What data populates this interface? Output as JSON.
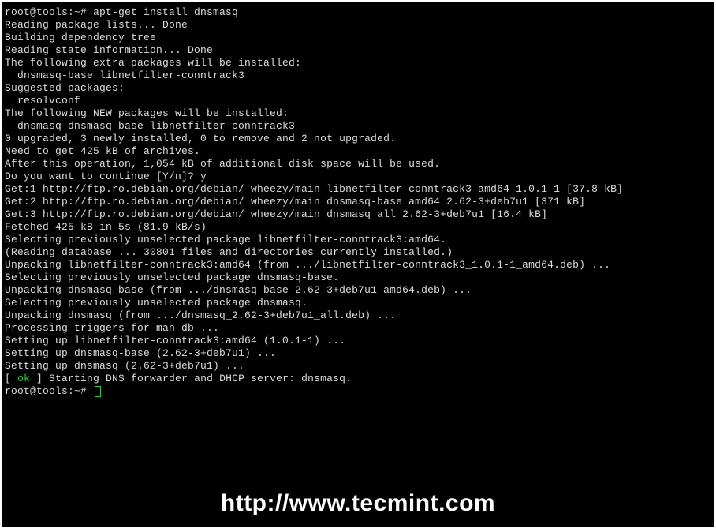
{
  "terminal": {
    "lines": [
      {
        "type": "prompt",
        "prompt": "root@tools:~#",
        "cmd": " apt-get install dnsmasq"
      },
      {
        "type": "plain",
        "text": "Reading package lists... Done"
      },
      {
        "type": "plain",
        "text": "Building dependency tree"
      },
      {
        "type": "plain",
        "text": "Reading state information... Done"
      },
      {
        "type": "plain",
        "text": "The following extra packages will be installed:"
      },
      {
        "type": "plain",
        "text": "  dnsmasq-base libnetfilter-conntrack3"
      },
      {
        "type": "plain",
        "text": "Suggested packages:"
      },
      {
        "type": "plain",
        "text": "  resolvconf"
      },
      {
        "type": "plain",
        "text": "The following NEW packages will be installed:"
      },
      {
        "type": "plain",
        "text": "  dnsmasq dnsmasq-base libnetfilter-conntrack3"
      },
      {
        "type": "plain",
        "text": "0 upgraded, 3 newly installed, 0 to remove and 2 not upgraded."
      },
      {
        "type": "plain",
        "text": "Need to get 425 kB of archives."
      },
      {
        "type": "plain",
        "text": "After this operation, 1,054 kB of additional disk space will be used."
      },
      {
        "type": "plain",
        "text": "Do you want to continue [Y/n]? y"
      },
      {
        "type": "plain",
        "text": "Get:1 http://ftp.ro.debian.org/debian/ wheezy/main libnetfilter-conntrack3 amd64 1.0.1-1 [37.8 kB]"
      },
      {
        "type": "plain",
        "text": "Get:2 http://ftp.ro.debian.org/debian/ wheezy/main dnsmasq-base amd64 2.62-3+deb7u1 [371 kB]"
      },
      {
        "type": "plain",
        "text": "Get:3 http://ftp.ro.debian.org/debian/ wheezy/main dnsmasq all 2.62-3+deb7u1 [16.4 kB]"
      },
      {
        "type": "plain",
        "text": "Fetched 425 kB in 5s (81.9 kB/s)"
      },
      {
        "type": "plain",
        "text": "Selecting previously unselected package libnetfilter-conntrack3:amd64."
      },
      {
        "type": "plain",
        "text": "(Reading database ... 30801 files and directories currently installed.)"
      },
      {
        "type": "plain",
        "text": "Unpacking libnetfilter-conntrack3:amd64 (from .../libnetfilter-conntrack3_1.0.1-1_amd64.deb) ..."
      },
      {
        "type": "plain",
        "text": "Selecting previously unselected package dnsmasq-base."
      },
      {
        "type": "plain",
        "text": "Unpacking dnsmasq-base (from .../dnsmasq-base_2.62-3+deb7u1_amd64.deb) ..."
      },
      {
        "type": "plain",
        "text": "Selecting previously unselected package dnsmasq."
      },
      {
        "type": "plain",
        "text": "Unpacking dnsmasq (from .../dnsmasq_2.62-3+deb7u1_all.deb) ..."
      },
      {
        "type": "plain",
        "text": "Processing triggers for man-db ..."
      },
      {
        "type": "plain",
        "text": "Setting up libnetfilter-conntrack3:amd64 (1.0.1-1) ..."
      },
      {
        "type": "plain",
        "text": "Setting up dnsmasq-base (2.62-3+deb7u1) ..."
      },
      {
        "type": "plain",
        "text": "Setting up dnsmasq (2.62-3+deb7u1) ..."
      },
      {
        "type": "ok",
        "pre": "[ ",
        "ok": "ok",
        "post": " ] Starting DNS forwarder and DHCP server: dnsmasq."
      },
      {
        "type": "prompt_cursor",
        "prompt": "root@tools:~#",
        "cmd": " "
      }
    ]
  },
  "watermark": "http://www.tecmint.com"
}
